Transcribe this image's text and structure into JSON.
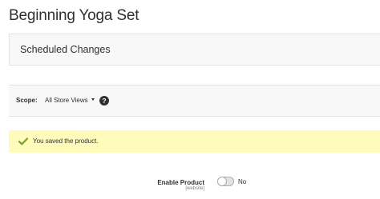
{
  "page": {
    "title": "Beginning Yoga Set"
  },
  "scheduled_changes": {
    "title": "Scheduled Changes"
  },
  "scope": {
    "label": "Scope:",
    "selected": "All Store Views",
    "help_icon": "question-circle-icon"
  },
  "message": {
    "type": "success",
    "icon": "check-icon",
    "text": "You saved the product.",
    "background": "#fffbbb",
    "icon_color": "#79a22e"
  },
  "enable_product": {
    "label": "Enable Product",
    "scope": "[website]",
    "state_label": "No",
    "enabled": false
  }
}
